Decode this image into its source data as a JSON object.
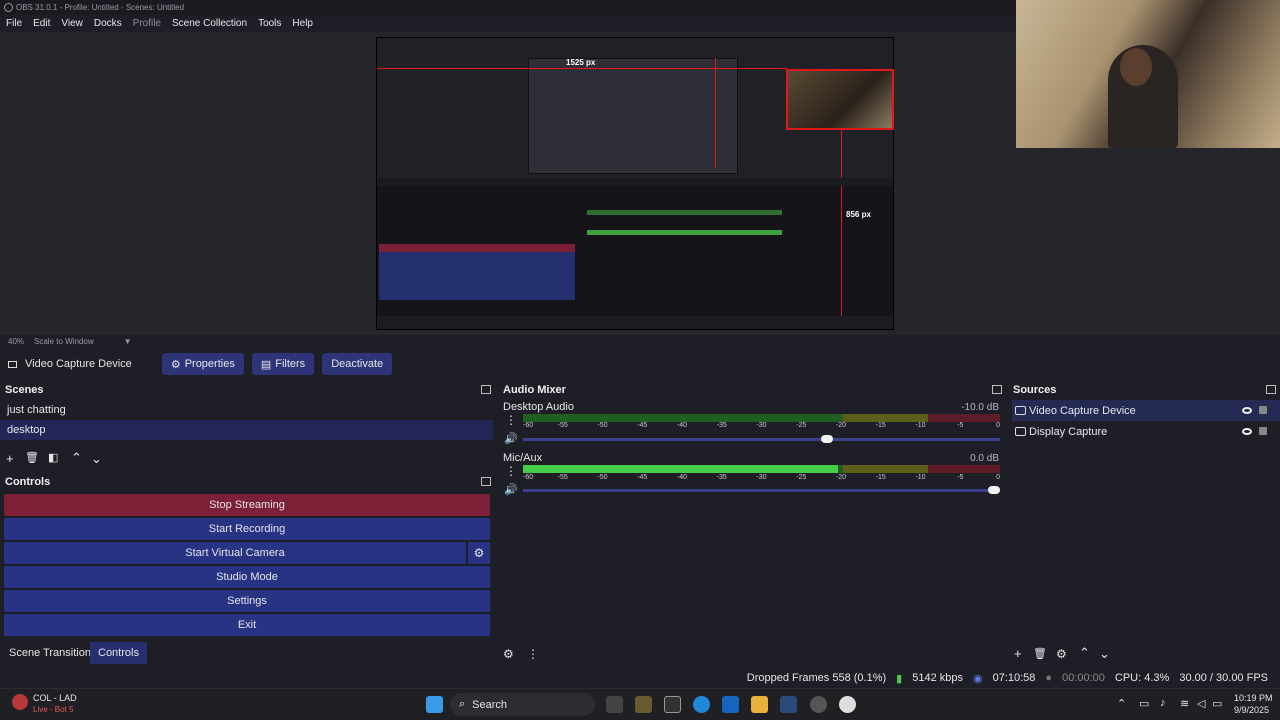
{
  "window": {
    "title": "OBS 31.0.1 - Profile: Untitled - Scenes: Untitled"
  },
  "menu": [
    "File",
    "Edit",
    "View",
    "Docks",
    "Profile",
    "Scene Collection",
    "Tools",
    "Help"
  ],
  "preview": {
    "width_label": "1525 px",
    "height_label": "856 px",
    "zoom": "40%",
    "scale_mode": "Scale to Window"
  },
  "source_toolbar": {
    "source_name": "Video Capture Device",
    "properties": "Properties",
    "filters": "Filters",
    "deactivate": "Deactivate"
  },
  "scenes": {
    "title": "Scenes",
    "items": [
      "just chatting",
      "desktop"
    ]
  },
  "controls": {
    "title": "Controls",
    "buttons": [
      "Stop Streaming",
      "Start Recording",
      "Start Virtual Camera",
      "Studio Mode",
      "Settings",
      "Exit"
    ]
  },
  "bottom_tabs": [
    "Scene Transitions",
    "Controls"
  ],
  "mixer": {
    "title": "Audio Mixer",
    "scale": [
      "-60",
      "-55",
      "-50",
      "-45",
      "-40",
      "-35",
      "-30",
      "-25",
      "-20",
      "-15",
      "-10",
      "-5",
      "0"
    ],
    "channels": [
      {
        "name": "Desktop Audio",
        "db": "-10.0 dB",
        "level": 0.0,
        "volume": 0.65
      },
      {
        "name": "Mic/Aux",
        "db": "0.0 dB",
        "level": 0.66,
        "volume": 1.0
      }
    ]
  },
  "sources": {
    "title": "Sources",
    "items": [
      "Video Capture Device",
      "Display Capture"
    ]
  },
  "status": {
    "dropped": "Dropped Frames 558 (0.1%)",
    "bitrate": "5142 kbps",
    "stream_time": "07:10:58",
    "rec_time": "00:00:00",
    "cpu": "CPU: 4.3%",
    "fps": "30.00 / 30.00 FPS"
  },
  "taskbar": {
    "app_name": "COL - LAD",
    "app_sub": "Live - Bot 5",
    "search": "Search",
    "time": "10:19 PM",
    "date": "9/9/2025"
  },
  "colors": {
    "accent": "#283383",
    "stop": "#7c2038",
    "meter_green": "#46cf46",
    "guide_red": "#e01818"
  }
}
